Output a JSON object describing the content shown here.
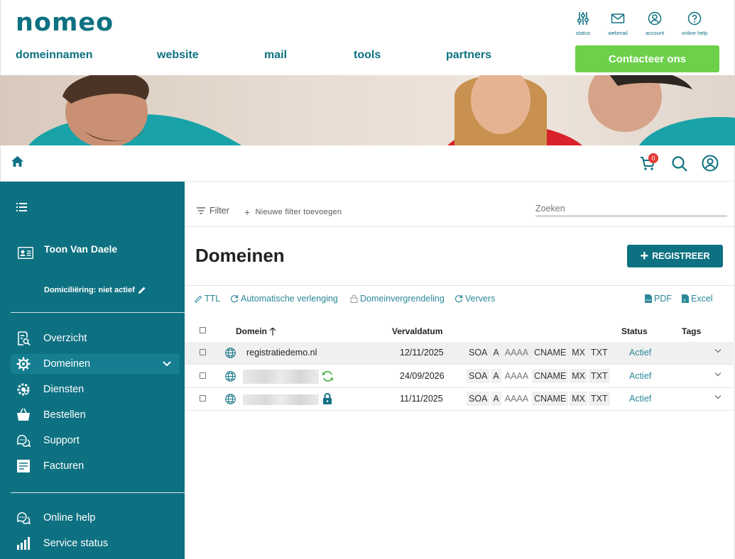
{
  "brand": {
    "logo_text": "nomeo",
    "accent": "#0e7182",
    "cta_color": "#6dd04a"
  },
  "top_icons": [
    {
      "label": "status",
      "icon": "sliders-icon"
    },
    {
      "label": "webmail",
      "icon": "envelope-icon"
    },
    {
      "label": "account",
      "icon": "user-circle-icon"
    },
    {
      "label": "online help",
      "icon": "question-circle-icon"
    }
  ],
  "nav": [
    "domeinnamen",
    "website",
    "mail",
    "tools",
    "partners"
  ],
  "contact_button": "Contacteer ons",
  "cart_count": "0",
  "sidebar": {
    "user_name": "Toon Van Daele",
    "domiciliation": "Domiciliëring: niet actief",
    "items": [
      {
        "label": "Overzicht",
        "icon": "overview-icon"
      },
      {
        "label": "Domeinen",
        "icon": "gear-icon"
      },
      {
        "label": "Diensten",
        "icon": "services-icon"
      },
      {
        "label": "Bestellen",
        "icon": "basket-icon"
      },
      {
        "label": "Support",
        "icon": "chat-icon"
      },
      {
        "label": "Facturen",
        "icon": "invoice-icon"
      }
    ],
    "bottom_items": [
      {
        "label": "Online help",
        "icon": "help-chat-icon"
      },
      {
        "label": "Service status",
        "icon": "bars-icon"
      }
    ]
  },
  "filter": {
    "filter_label": "Filter",
    "add_filter_label": "Nieuwe filter toevoegen",
    "search_placeholder": "Zoeken"
  },
  "page": {
    "title": "Domeinen",
    "register_button": "REGISTREER"
  },
  "toolbar": {
    "ttl": "TTL",
    "auto_renew": "Automatische verlenging",
    "lock": "Domeinvergrendeling",
    "refresh": "Ververs",
    "pdf": "PDF",
    "excel": "Excel"
  },
  "table": {
    "headers": {
      "domain": "Domein",
      "expiry": "Vervaldatum",
      "status": "Status",
      "tags": "Tags"
    },
    "rows": [
      {
        "domain": "registratiedemo.nl",
        "expiry": "12/11/2025",
        "status": "Actief",
        "badge": ""
      },
      {
        "domain": "",
        "expiry": "24/09/2026",
        "status": "Actief",
        "badge": "sync-icon"
      },
      {
        "domain": "",
        "expiry": "11/11/2025",
        "status": "Actief",
        "badge": "lock-icon"
      }
    ],
    "records": [
      "SOA",
      "A",
      "AAAA",
      "CNAME",
      "MX",
      "TXT"
    ]
  }
}
